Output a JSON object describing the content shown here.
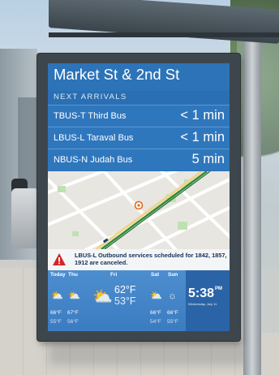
{
  "stop": {
    "name": "Market St & 2nd St",
    "section_label": "NEXT ARRIVALS"
  },
  "arrivals": [
    {
      "route": "TBUS-T Third Bus",
      "eta": "< 1 min"
    },
    {
      "route": "LBUS-L Taraval Bus",
      "eta": "< 1 min"
    },
    {
      "route": "NBUS-N Judah Bus",
      "eta": "5 min"
    }
  ],
  "alert": {
    "text": "LBUS-L Outbound services scheduled for 1842, 1857, 1912 are canceled.",
    "icon": "warning-triangle-icon"
  },
  "weather": {
    "days": [
      {
        "label": "Today",
        "icon": "partly-cloudy-icon",
        "hi": "66°F",
        "lo": "55°F"
      },
      {
        "label": "Thu",
        "icon": "partly-cloudy-icon",
        "hi": "67°F",
        "lo": "56°F"
      },
      {
        "label": "Fri",
        "icon": "partly-cloudy-icon",
        "hi": "62°F",
        "lo": "53°F"
      },
      {
        "label": "Sat",
        "icon": "partly-cloudy-icon",
        "hi": "66°F",
        "lo": "54°F"
      },
      {
        "label": "Sun",
        "icon": "sunny-icon",
        "hi": "66°F",
        "lo": "55°F"
      }
    ]
  },
  "clock": {
    "time": "5:38",
    "ampm": "PM",
    "date": "Wednesday, July 11"
  },
  "colors": {
    "screen_blue": "#2a6fb3",
    "route_line": "#2f8a3a",
    "alert_red": "#d3262b"
  }
}
